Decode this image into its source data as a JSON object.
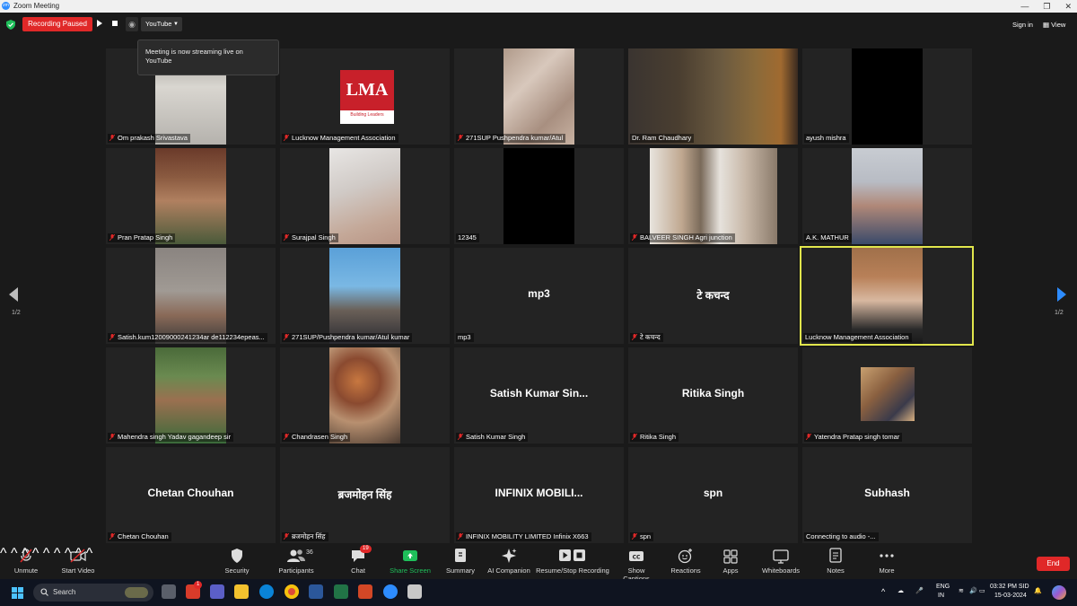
{
  "window": {
    "title": "Zoom Meeting",
    "app_icon": "zoom-logo-icon",
    "controls": [
      "minimize",
      "restore",
      "close"
    ]
  },
  "topbar": {
    "recording_label": "Recording Paused",
    "stream_platform": "YouTube",
    "sign_in": "Sign in",
    "view": "View"
  },
  "tooltip": {
    "text": "Meeting is now streaming live on YouTube"
  },
  "gallery": {
    "page_left": "1/2",
    "page_right": "1/2",
    "tiles": [
      {
        "name": "Om prakash Srivastava",
        "display": "",
        "muted": true
      },
      {
        "name": "Lucknow Management Association",
        "display": "",
        "muted": true
      },
      {
        "name": "271SUP Pushpendra kumar/Atul",
        "display": "",
        "muted": true
      },
      {
        "name": "Dr. Ram Chaudhary",
        "display": "",
        "muted": false
      },
      {
        "name": "ayush mishra",
        "display": "",
        "muted": false
      },
      {
        "name": "Pran Pratap Singh",
        "display": "",
        "muted": true
      },
      {
        "name": "Surajpal Singh",
        "display": "",
        "muted": true
      },
      {
        "name": "12345",
        "display": "",
        "muted": false
      },
      {
        "name": "BALVEER SINGH Agri junction",
        "display": "",
        "muted": true
      },
      {
        "name": "A.K. MATHUR",
        "display": "",
        "muted": false
      },
      {
        "name": "Satish.kum12009000241234ar de112234epeas...",
        "display": "",
        "muted": true
      },
      {
        "name": "271SUP/Pushpendra kumar/Atul kumar",
        "display": "",
        "muted": true
      },
      {
        "name": "mp3",
        "display": "mp3",
        "muted": false
      },
      {
        "name": "टे कचन्द",
        "display": "टे कचन्द",
        "muted": true
      },
      {
        "name": "Lucknow Management Association",
        "display": "",
        "muted": false
      },
      {
        "name": "Mahendra singh Yadav gagandeep sir",
        "display": "",
        "muted": true
      },
      {
        "name": "Chandrasen Singh",
        "display": "",
        "muted": true
      },
      {
        "name": "Satish Kumar Singh",
        "display": "Satish Kumar Sin...",
        "muted": true
      },
      {
        "name": "Ritika Singh",
        "display": "Ritika Singh",
        "muted": true
      },
      {
        "name": "Yatendra Pratap singh tomar",
        "display": "",
        "muted": true
      },
      {
        "name": "Chetan Chouhan",
        "display": "Chetan Chouhan",
        "muted": true
      },
      {
        "name": "ब्रजमोहन सिंह",
        "display": "ब्रजमोहन सिंह",
        "muted": true
      },
      {
        "name": "INFINIX MOBILITY LIMITED Infinix X663",
        "display": "INFINIX MOBILI...",
        "muted": true
      },
      {
        "name": "spn",
        "display": "spn",
        "muted": true
      },
      {
        "name": "Connecting to audio -...",
        "display": "Subhash",
        "muted": false
      }
    ],
    "lma_logo": {
      "text": "LMA",
      "sub": "Building Leaders"
    }
  },
  "toolbar": {
    "unmute": "Unmute",
    "start_video": "Start Video",
    "security": "Security",
    "participants": "Participants",
    "participants_count": "36",
    "chat": "Chat",
    "chat_badge": "19",
    "share_screen": "Share Screen",
    "summary": "Summary",
    "ai_companion": "AI Companion",
    "resume_stop_recording": "Resume/Stop Recording",
    "show_captions": "Show Captions",
    "reactions": "Reactions",
    "apps": "Apps",
    "whiteboards": "Whiteboards",
    "notes": "Notes",
    "more": "More",
    "end": "End"
  },
  "taskbar": {
    "search_placeholder": "Search",
    "lang_top": "ENG",
    "lang_bottom": "IN",
    "time": "03:32 PM SID",
    "date": "15-03-2024",
    "notification_badge": "1"
  },
  "colors": {
    "accent": "#2d8cff",
    "record": "#e02828",
    "active_speaker": "#e1e64c",
    "share_green": "#1fbf5a"
  }
}
